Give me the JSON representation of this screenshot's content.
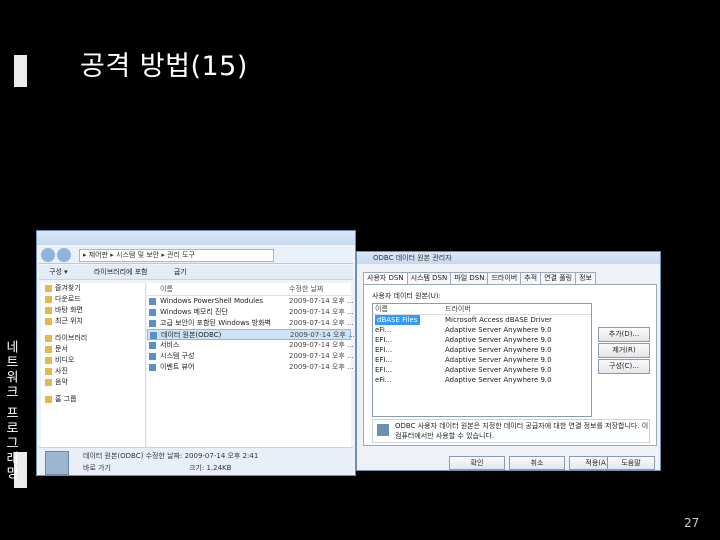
{
  "slide": {
    "title": "공격 방법(15)",
    "side_label": "네트워크 프로그래밍",
    "page_number": "27"
  },
  "explorer": {
    "address_path": "▸ 제어판 ▸ 시스템 및 보안 ▸ 관리 도구",
    "toolbar": [
      "구성 ▾",
      "라이브러리에 포함",
      "굽기"
    ],
    "sidebar_items": [
      "즐겨찾기",
      "다운로드",
      "바탕 화면",
      "최근 위치",
      "라이브러리",
      "문서",
      "비디오",
      "사진",
      "음악",
      "홈 그룹"
    ],
    "column_headers": {
      "name": "이름",
      "date": "수정한 날짜"
    },
    "rows": [
      {
        "name": "Windows PowerShell Modules",
        "date": "2009-07-14 오후 ..."
      },
      {
        "name": "Windows 메모리 진단",
        "date": "2009-07-14 오후 ..."
      },
      {
        "name": "고급 보안이 포함된 Windows 방화벽",
        "date": "2009-07-14 오후 ..."
      },
      {
        "name": "데이터 원본(ODBC)",
        "date": "2009-07-14 오후 ..."
      },
      {
        "name": "서비스",
        "date": "2009-07-14 오후 ..."
      },
      {
        "name": "시스템 구성",
        "date": "2009-07-14 오후 ..."
      },
      {
        "name": "이벤트 뷰어",
        "date": "2009-07-14 오후 ..."
      }
    ],
    "selected_row": 3,
    "status": {
      "line1": "데이터 원본(ODBC) 수정한 날짜: 2009-07-14 오후 2:41",
      "line2": "바로 가기",
      "line3": "크기: 1.24KB"
    }
  },
  "odbc": {
    "title": "ODBC 데이터 원본 관리자",
    "tabs": [
      "사용자 DSN",
      "시스템 DSN",
      "파일 DSN",
      "드라이버",
      "추적",
      "연결 풀링",
      "정보"
    ],
    "active_tab": 0,
    "list_label": "사용자 데이터 원본(U):",
    "list_headers": {
      "name": "이름",
      "driver": "드라이버"
    },
    "rows": [
      {
        "name": "dBASE Files",
        "driver": "Microsoft Access dBASE Driver"
      },
      {
        "name": "eFi...",
        "driver": "Adaptive Server Anywhere 9.0"
      },
      {
        "name": "EFI...",
        "driver": "Adaptive Server Anywhere 9.0"
      },
      {
        "name": "EFI...",
        "driver": "Adaptive Server Anywhere 9.0"
      },
      {
        "name": "EFI...",
        "driver": "Adaptive Server Anywhere 9.0"
      },
      {
        "name": "EFI...",
        "driver": "Adaptive Server Anywhere 9.0"
      },
      {
        "name": "eFi...",
        "driver": "Adaptive Server Anywhere 9.0"
      }
    ],
    "side_buttons": [
      "추가(D)...",
      "제거(R)",
      "구성(C)..."
    ],
    "info_text": "ODBC 사용자 데이터 원본은 지정한 데이터 공급자에 대한 연결 정보를 저장합니다. 이 컴퓨터에서만 사용할 수 있습니다.",
    "buttons": [
      "확인",
      "취소",
      "적용(A)",
      "도움말"
    ]
  }
}
